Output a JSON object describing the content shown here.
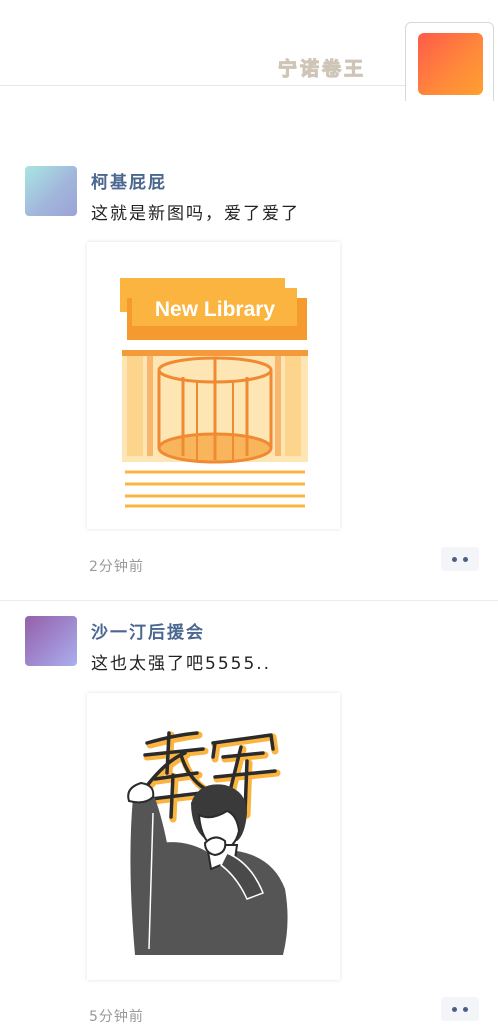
{
  "header": {
    "title": "宁诺卷王",
    "accent": "#ff7a3d"
  },
  "posts": [
    {
      "author": "柯基屁屁",
      "text": "这就是新图吗，爱了爱了",
      "image_caption": "New Library",
      "time": "2分钟前",
      "avatar_colors": [
        "#a8e3e3",
        "#9aa6d8"
      ]
    },
    {
      "author": "沙一汀后援会",
      "text": "这也太强了吧5555..",
      "image_caption": "季军",
      "time": "5分钟前",
      "avatar_colors": [
        "#9b6bb0",
        "#a7a9ec"
      ]
    }
  ],
  "icons": {
    "more": "more-dots-icon"
  }
}
